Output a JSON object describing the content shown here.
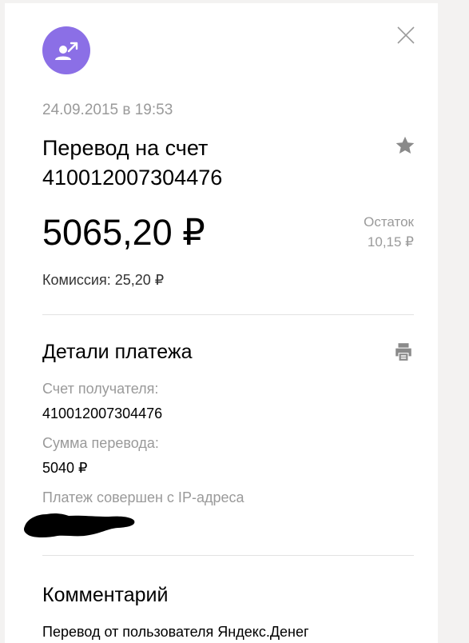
{
  "header": {
    "avatar_icon": "transfer-user-icon",
    "avatar_color": "#8b6fe6",
    "close_icon": "close-icon"
  },
  "transaction": {
    "datetime": "24.09.2015 в 19:53",
    "title": "Перевод на счет 410012007304476",
    "amount": "5065,20 ₽",
    "balance_label": "Остаток",
    "balance_value": "10,15 ₽",
    "commission": "Комиссия: 25,20 ₽"
  },
  "details": {
    "title": "Детали платежа",
    "recipient_label": "Счет получателя:",
    "recipient_value": "410012007304476",
    "transfer_sum_label": "Сумма перевода:",
    "transfer_sum_value": "5040 ₽",
    "ip_label": "Платеж совершен с IP-адреса"
  },
  "comment": {
    "title": "Комментарий",
    "text": "Перевод от пользователя Яндекс.Денег"
  }
}
